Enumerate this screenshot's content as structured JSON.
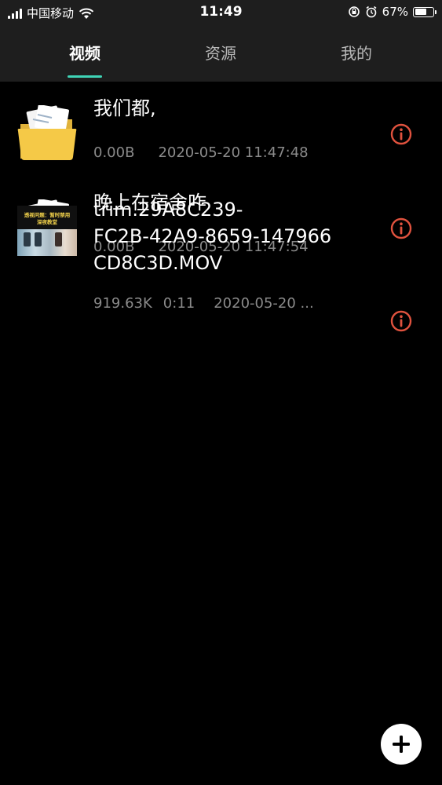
{
  "status_bar": {
    "carrier": "中国移动",
    "time": "11:49",
    "battery_percent": "67%",
    "battery_level": 0.67,
    "icons": [
      "signal-icon",
      "wifi-icon",
      "orientation-lock-icon",
      "alarm-icon",
      "battery-icon"
    ]
  },
  "tabs": [
    {
      "label": "视频",
      "active": true
    },
    {
      "label": "资源",
      "active": false
    },
    {
      "label": "我的",
      "active": false
    }
  ],
  "colors": {
    "accent": "#3fd4b6",
    "info_icon": "#e0523e",
    "folder": "#f2c744",
    "meta_text": "#8a8a8a"
  },
  "items": [
    {
      "type": "folder",
      "title": "我们都,",
      "size": "0.00B",
      "date": "2020-05-20 11:47:48",
      "icon": "folder-icon"
    },
    {
      "type": "folder",
      "title": "晚上在宿舍咋",
      "size": "0.00B",
      "date": "2020-05-20 11:47:54",
      "icon": "folder-icon"
    },
    {
      "type": "video",
      "title_lines": [
        "trim.29A8C239-",
        "FC2B-42A9-8659-147966",
        "CD8C3D.MOV"
      ],
      "size": "919.63K",
      "duration": "0:11",
      "date": "2020-05-20 ...",
      "thumb_text": [
        "透视问题：暂时禁用",
        "深夜教堂"
      ]
    }
  ],
  "fab": {
    "icon": "plus-icon"
  }
}
